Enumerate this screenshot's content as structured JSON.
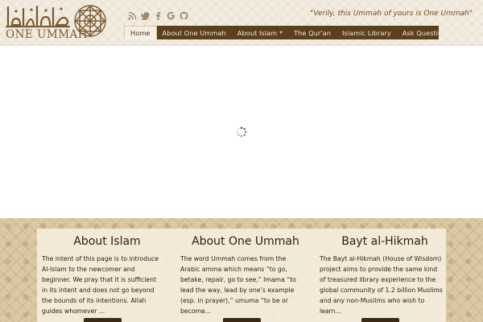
{
  "brand": {
    "logo_text": "ONE UMMAH",
    "tagline": "\"Verily, this Ummah of yours is One Ummah\""
  },
  "social": [
    "rss-icon",
    "twitter-icon",
    "facebook-icon",
    "google-icon",
    "github-icon"
  ],
  "nav": {
    "items": [
      {
        "label": "Home",
        "active": true
      },
      {
        "label": "About One Ummah"
      },
      {
        "label": "About Islam",
        "dropdown": true
      },
      {
        "label": "The Qur'an"
      },
      {
        "label": "Islamic Library"
      },
      {
        "label": "Ask Questions"
      }
    ]
  },
  "main": {
    "loading_icon": "spinner-icon"
  },
  "footer": {
    "columns": [
      {
        "title": "About Islam",
        "body": "The intent of this page is to introduce\nAl-Islam to the newcomer and\nbeginner.  We pray that it is sufficient\nin its intent and does not go beyond\nthe bounds of its intentions.  Allah\nguides whomever ..."
      },
      {
        "title": "About One Ummah",
        "body": "The word Ummah comes from the\nArabic amma which means “to go,\nbetake, repair, go to see,” Imama “to\nlead the way, lead by one’s example\n(esp. in prayer),” umuma “to be or\nbecome..."
      },
      {
        "title": "Bayt al-Hikmah",
        "body": "The Bayt al-Hikmah (House of Wisdom)\nproject aims to provide the same kind\nof treasured library experience to the\nglobal community of 1.2 billion Muslims\nand any non-Muslims who wish to\nlearn..."
      }
    ]
  },
  "colors": {
    "nav_bg": "#5c3f1c",
    "brand_brown": "#7a5a32",
    "header_bg": "#f3ece0",
    "footer_bg": "#dcc9a4",
    "button_bg": "#3b2a15"
  }
}
